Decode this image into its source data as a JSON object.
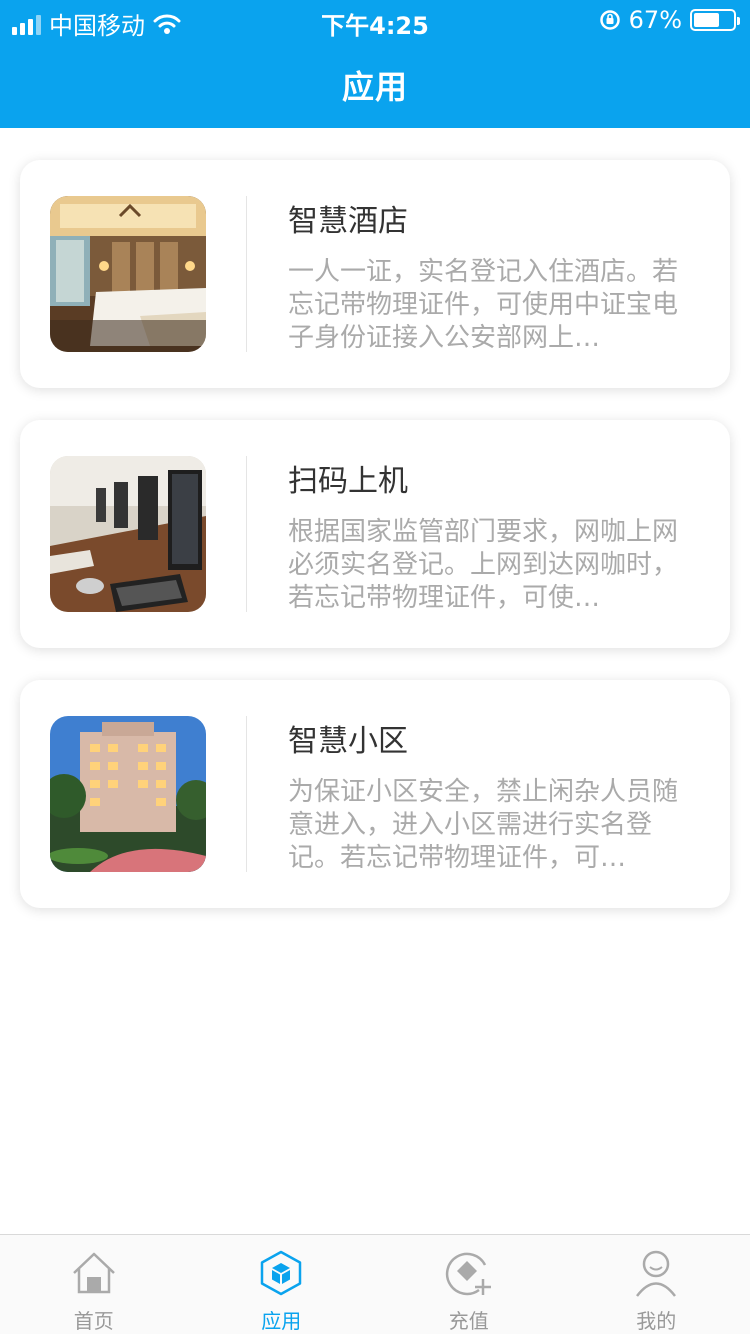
{
  "status_bar": {
    "carrier": "中国移动",
    "time": "下午4:25",
    "battery": "67%",
    "battery_level": 0.67
  },
  "header": {
    "title": "应用"
  },
  "cards": [
    {
      "title": "智慧酒店",
      "description": "一人一证，实名登记入住酒店。若忘记带物理证件，可使用中证宝电子身份证接入公安部网上…"
    },
    {
      "title": "扫码上机",
      "description": "根据国家监管部门要求，网咖上网必须实名登记。上网到达网咖时，若忘记带物理证件，可使…"
    },
    {
      "title": "智慧小区",
      "description": "为保证小区安全，禁止闲杂人员随意进入，进入小区需进行实名登记。若忘记带物理证件，可…"
    }
  ],
  "tabs": [
    {
      "label": "首页",
      "icon": "home-icon",
      "active": false
    },
    {
      "label": "应用",
      "icon": "cube-icon",
      "active": true
    },
    {
      "label": "充值",
      "icon": "recharge-icon",
      "active": false
    },
    {
      "label": "我的",
      "icon": "user-icon",
      "active": false
    }
  ],
  "colors": {
    "primary": "#0aa3ee",
    "inactive": "#999999"
  }
}
